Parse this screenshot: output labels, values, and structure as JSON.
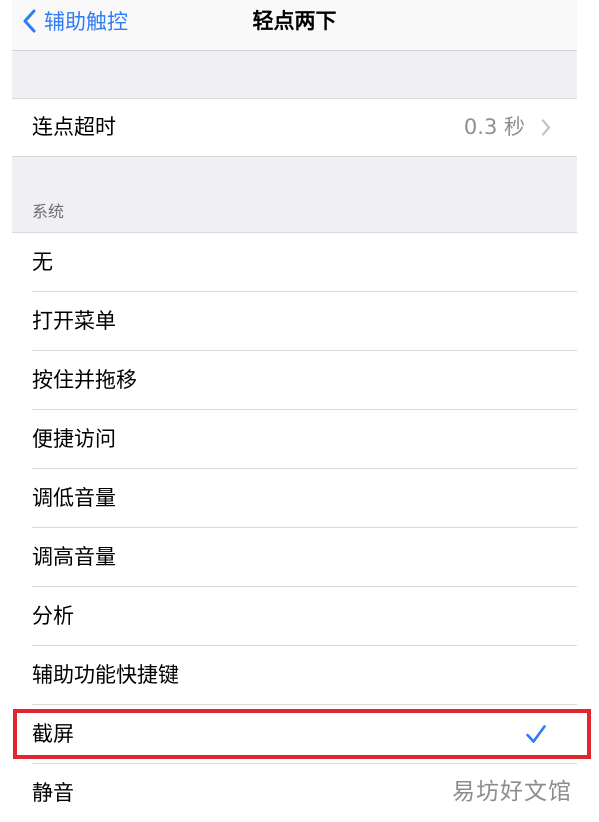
{
  "navbar": {
    "back_label": "辅助触控",
    "title": "轻点两下"
  },
  "timeout": {
    "label": "连点超时",
    "value": "0.3 秒"
  },
  "system_section": {
    "header": "系统",
    "items": [
      {
        "label": "无",
        "selected": false
      },
      {
        "label": "打开菜单",
        "selected": false
      },
      {
        "label": "按住并拖移",
        "selected": false
      },
      {
        "label": "便捷访问",
        "selected": false
      },
      {
        "label": "调低音量",
        "selected": false
      },
      {
        "label": "调高音量",
        "selected": false
      },
      {
        "label": "分析",
        "selected": false
      },
      {
        "label": "辅助功能快捷键",
        "selected": false
      },
      {
        "label": "截屏",
        "selected": true
      },
      {
        "label": "静音",
        "selected": false
      }
    ]
  },
  "watermark": "易坊好文馆",
  "colors": {
    "accent": "#2f7cf6",
    "highlight": "#e0262e",
    "group_background": "#efeff4"
  }
}
